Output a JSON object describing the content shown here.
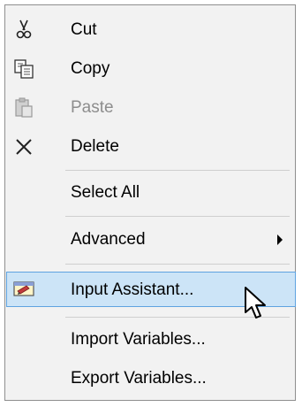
{
  "menu": {
    "items": [
      {
        "label": "Cut",
        "icon": "scissors-icon"
      },
      {
        "label": "Copy",
        "icon": "copy-icon"
      },
      {
        "label": "Paste",
        "icon": "paste-icon",
        "disabled": true
      },
      {
        "label": "Delete",
        "icon": "delete-icon"
      },
      {
        "label": "Select All"
      },
      {
        "label": "Advanced",
        "submenu": true
      },
      {
        "label": "Input Assistant...",
        "icon": "input-assistant-icon",
        "highlighted": true
      },
      {
        "label": "Import Variables..."
      },
      {
        "label": "Export Variables..."
      }
    ]
  },
  "colors": {
    "highlight_bg": "#cce4f7",
    "highlight_border": "#5fa3e0",
    "disabled_text": "#8d8d8d"
  }
}
